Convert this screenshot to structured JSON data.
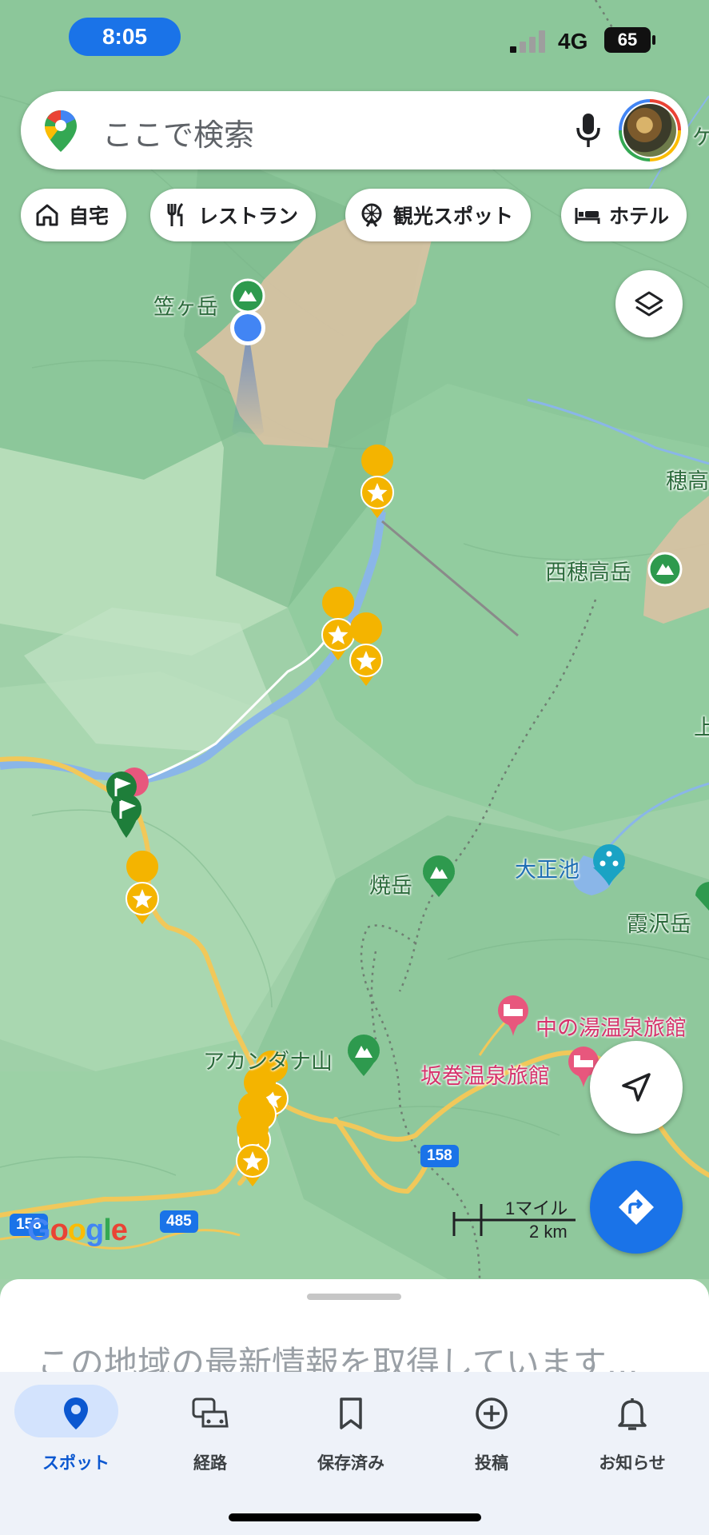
{
  "status_bar": {
    "time": "8:05",
    "network": "4G",
    "battery": "65"
  },
  "search": {
    "placeholder": "ここで検索"
  },
  "chips": [
    {
      "label": "自宅",
      "icon": "home-icon"
    },
    {
      "label": "レストラン",
      "icon": "restaurant-icon"
    },
    {
      "label": "観光スポット",
      "icon": "attraction-icon"
    },
    {
      "label": "ホテル",
      "icon": "hotel-icon"
    }
  ],
  "map": {
    "labels": {
      "kasagatake": "笠ヶ岳",
      "nishihotaka": "西穂高岳",
      "hotaka": "穂高",
      "yakedake": "焼岳",
      "taishoike": "大正池",
      "kasumisawa": "霞沢岳",
      "akandana": "アカンダナ山",
      "nakanoyu": "中の湯温泉旅館",
      "sakamaki": "坂巻温泉旅館",
      "ue": "上",
      "ke": "ケ"
    },
    "roads": {
      "r158a": "158",
      "r158b": "158",
      "r485": "485"
    },
    "scale": {
      "miles": "1マイル",
      "km": "2 km"
    },
    "attribution": "Google"
  },
  "colors": {
    "accent": "#1a73e8",
    "map_green": "#a8d5b0",
    "pin_yellow": "#f4b400",
    "pin_pink": "#e8577d"
  },
  "sheet": {
    "message": "この地域の最新情報を取得しています..."
  },
  "nav": [
    {
      "label": "スポット",
      "icon": "location-pin-icon",
      "active": true
    },
    {
      "label": "経路",
      "icon": "commute-icon",
      "active": false
    },
    {
      "label": "保存済み",
      "icon": "bookmark-icon",
      "active": false
    },
    {
      "label": "投稿",
      "icon": "add-circle-icon",
      "active": false
    },
    {
      "label": "お知らせ",
      "icon": "bell-icon",
      "active": false
    }
  ]
}
